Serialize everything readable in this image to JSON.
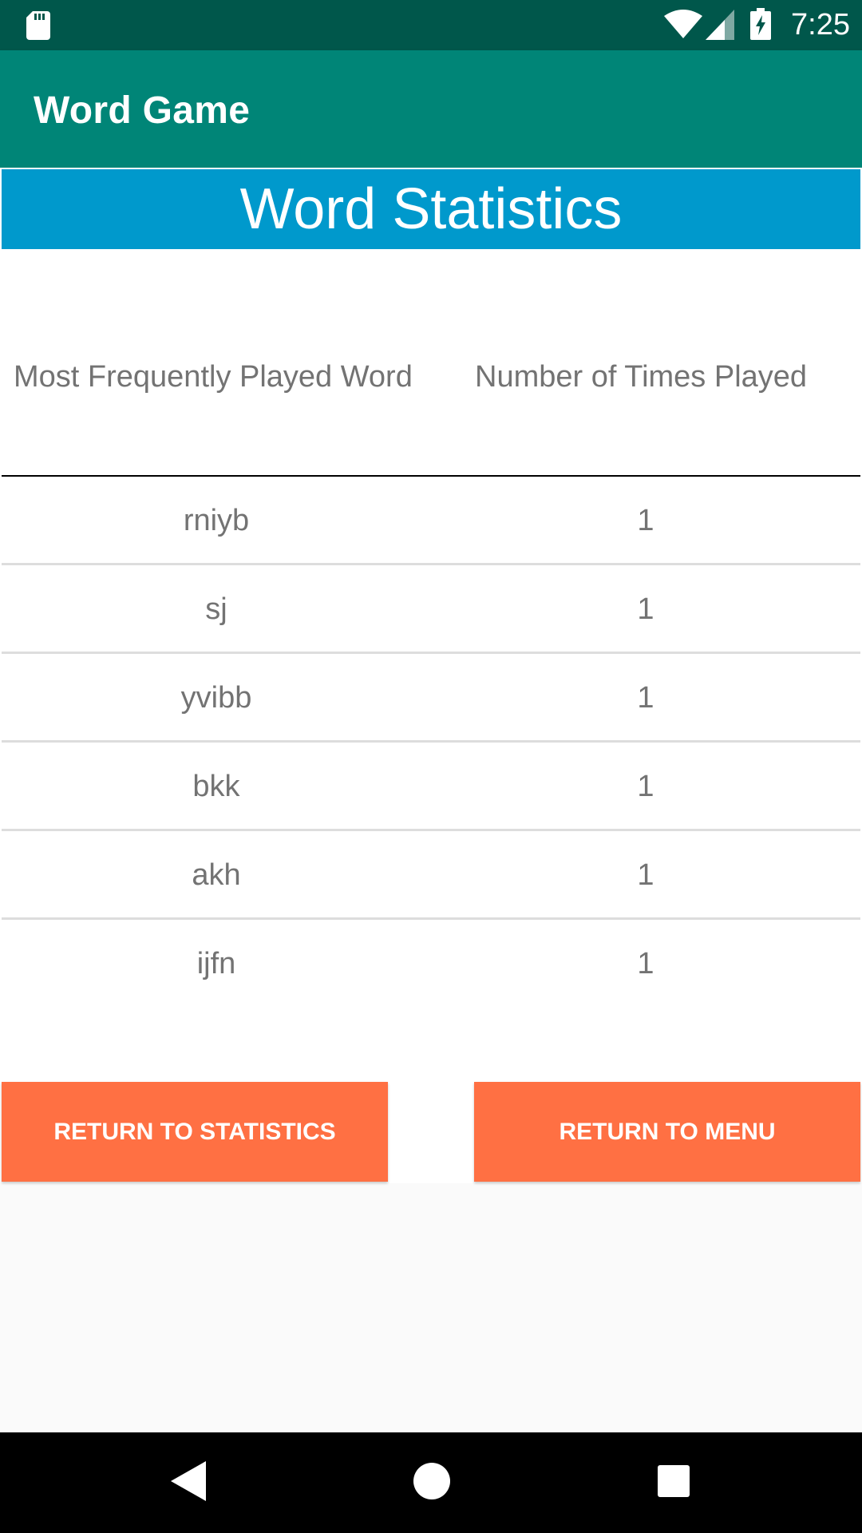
{
  "status_bar": {
    "time": "7:25",
    "icons": [
      "sd-card-icon",
      "wifi-icon",
      "signal-icon",
      "battery-charging-icon"
    ]
  },
  "app_bar": {
    "title": "Word Game"
  },
  "page": {
    "title": "Word Statistics"
  },
  "table": {
    "headers": {
      "word": "Most Frequently Played Word",
      "count": "Number of Times Played"
    },
    "rows": [
      {
        "word": "rniyb",
        "count": "1"
      },
      {
        "word": "sj",
        "count": "1"
      },
      {
        "word": "yvibb",
        "count": "1"
      },
      {
        "word": "bkk",
        "count": "1"
      },
      {
        "word": "akh",
        "count": "1"
      },
      {
        "word": "ijfn",
        "count": "1"
      }
    ]
  },
  "buttons": {
    "return_to_statistics": "RETURN TO STATISTICS",
    "return_to_menu": "RETURN TO MENU"
  },
  "nav_bar": {
    "icons": [
      "back-icon",
      "home-icon",
      "recents-icon"
    ]
  },
  "colors": {
    "status_bar": "#00574b",
    "app_bar": "#008577",
    "header_banner": "#0099cc",
    "button": "#ff7043",
    "text_gray": "#737373"
  }
}
